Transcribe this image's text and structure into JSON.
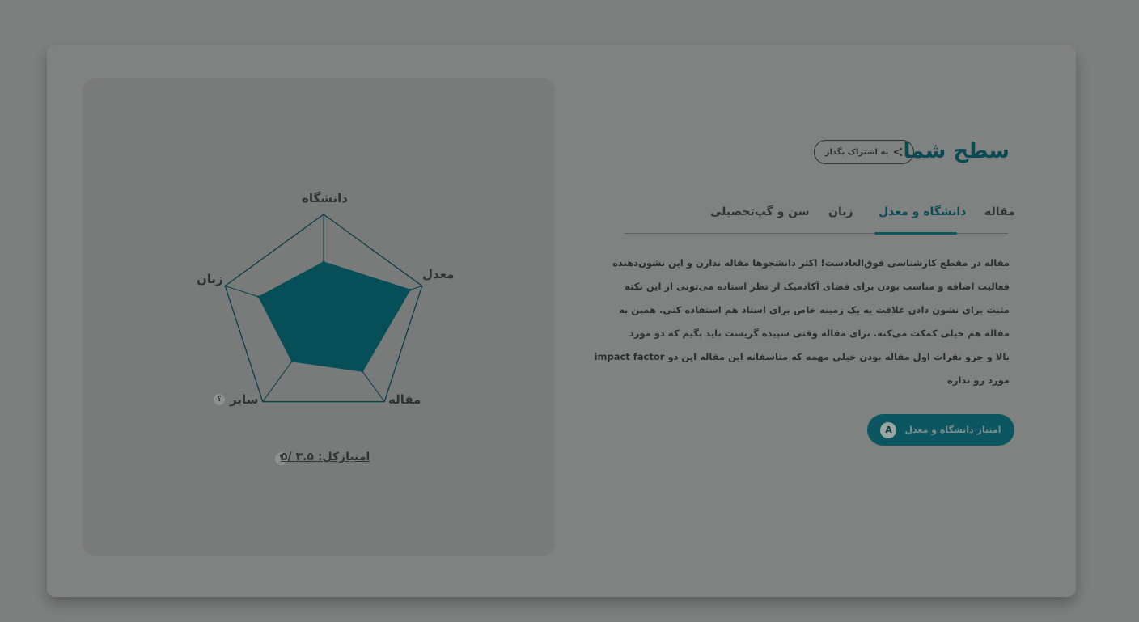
{
  "panel": {
    "axes": [
      {
        "key": "university",
        "label": "دانشگاه"
      },
      {
        "key": "gpa",
        "label": "معدل"
      },
      {
        "key": "article",
        "label": "مقاله"
      },
      {
        "key": "other",
        "label": "سایر"
      },
      {
        "key": "language",
        "label": "زبان"
      }
    ],
    "other_info": "؟",
    "score_text": "امتیازکل: ۳.۵ /۵",
    "score_info": "؟"
  },
  "chart_data": {
    "type": "radar",
    "axes": [
      "دانشگاه",
      "معدل",
      "مقاله",
      "سایر",
      "زبان"
    ],
    "max": 5,
    "values": [
      2.7,
      4.4,
      3.2,
      2.6,
      3.3
    ]
  },
  "header": {
    "title": "سطح شما",
    "share_label": "به اشتراک بگذار"
  },
  "tabs": [
    {
      "label": "مقاله"
    },
    {
      "label": "دانشگاه و معدل",
      "active": true
    },
    {
      "label": "زبان"
    },
    {
      "label": "سن و گپ‌تحصیلی"
    }
  ],
  "description": [
    "مقاله در مقطع کارشناسی فوق‌العادست! اکثر دانشجوها مقاله ندارن و این نشون‌دهنده",
    "فعالیت اضافه و مناسب بودن برای فضای آکادمیک از نظر استاده می‌تونی از این نکته",
    "مثبت برای نشون دادن علاقت به یک زمینه خاص برای استاد هم استفاده کنی. همین به",
    "مقاله هم خیلی کمکت می‌کنه. برای مقاله وقتی سپیده گریست باید بگیم که دو مورد",
    "بالا و جزو نفرات اول مقاله بودن خیلی مهمه که متاسفانه این مقاله این دو impact factor",
    "مورد رو نداره"
  ],
  "cta": {
    "label": "امتیاز دانشگاه و معدل",
    "badge": "A"
  },
  "colors": {
    "accent": "#0b5660",
    "overlay": "#7e807f"
  }
}
